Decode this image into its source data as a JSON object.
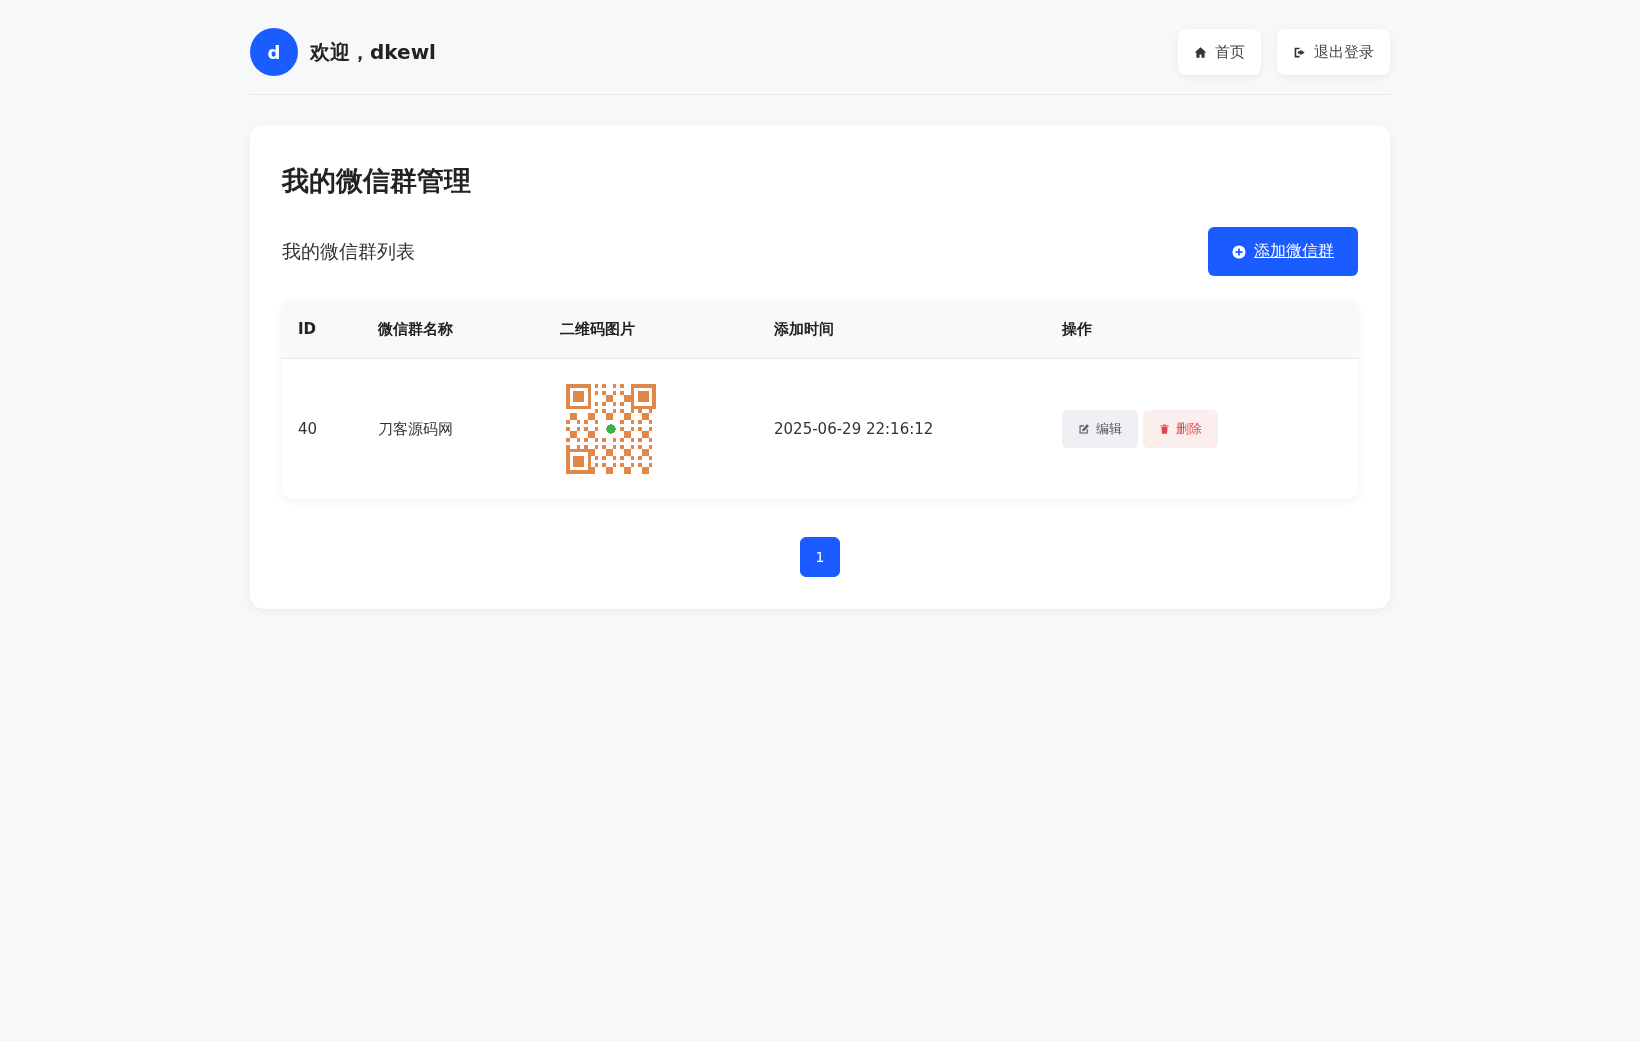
{
  "header": {
    "avatar_letter": "d",
    "welcome": "欢迎，dkewl",
    "nav": [
      {
        "kind": "home",
        "label": "首页"
      },
      {
        "kind": "logout",
        "label": "退出登录"
      }
    ]
  },
  "card": {
    "title": "我的微信群管理",
    "subtitle": "我的微信群列表",
    "add_button": "添加微信群",
    "table": {
      "columns": [
        "ID",
        "微信群名称",
        "二维码图片",
        "添加时间",
        "操作"
      ],
      "rows": [
        {
          "id": "40",
          "name": "刀客源码网",
          "time": "2025-06-29 22:16:12",
          "actions": [
            {
              "kind": "edit",
              "label": "编辑"
            },
            {
              "kind": "delete",
              "label": "删除"
            }
          ]
        }
      ]
    },
    "pagination": [
      {
        "label": "1",
        "selected": true
      }
    ]
  }
}
